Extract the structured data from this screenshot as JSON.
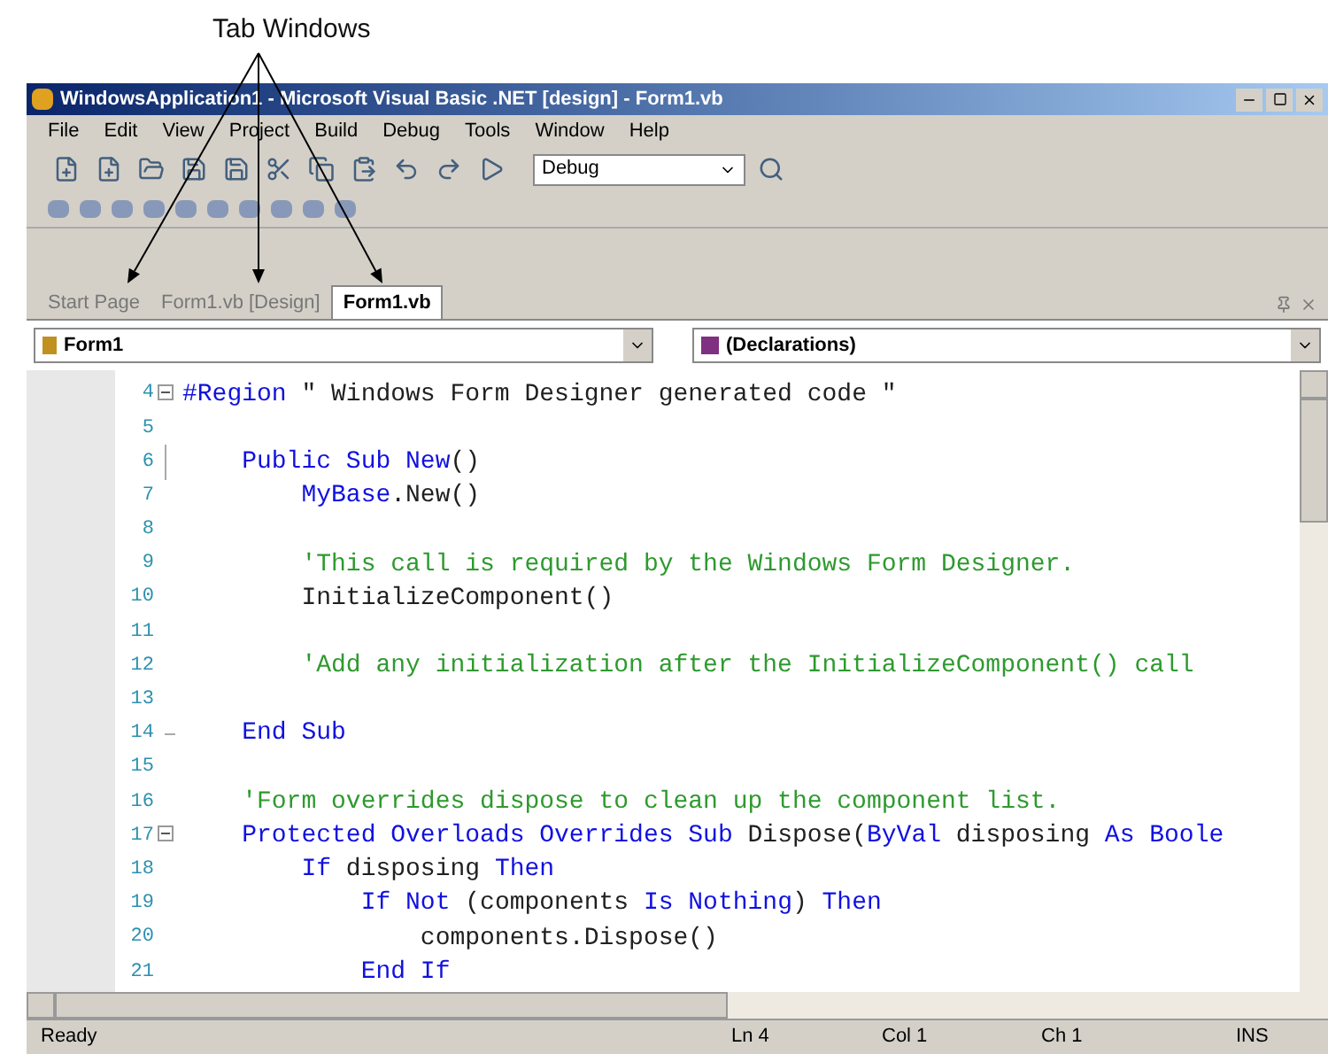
{
  "annotation": {
    "label": "Tab Windows"
  },
  "window": {
    "title": "WindowsApplication1 - Microsoft Visual Basic .NET [design] - Form1.vb"
  },
  "menu": [
    "File",
    "Edit",
    "View",
    "Project",
    "Build",
    "Debug",
    "Tools",
    "Window",
    "Help"
  ],
  "toolbar": {
    "configuration": "Debug"
  },
  "tabs": [
    {
      "label": "Start Page",
      "selected": false
    },
    {
      "label": "Form1.vb [Design]",
      "selected": false
    },
    {
      "label": "Form1.vb",
      "selected": true
    }
  ],
  "class_dropdown": {
    "value": "Form1"
  },
  "method_dropdown": {
    "value": "(Declarations)"
  },
  "code_lines": [
    {
      "number": "4",
      "kind": "collapsible",
      "segments": [
        {
          "kind": "keyword",
          "text": "#Region"
        },
        {
          "kind": "text",
          "text": " \" Windows Form Designer generated code \""
        }
      ]
    },
    {
      "number": "5"
    },
    {
      "number": "6",
      "kind": "guide",
      "segments": [
        {
          "kind": "keyword",
          "text": "    Public Sub New"
        },
        {
          "kind": "text",
          "text": "()"
        }
      ]
    },
    {
      "number": "7",
      "segments": [
        {
          "kind": "keyword",
          "text": "        MyBase"
        },
        {
          "kind": "text",
          "text": ".New()"
        }
      ]
    },
    {
      "number": "8"
    },
    {
      "number": "9",
      "segments": [
        {
          "kind": "comment",
          "text": "        'This call is required by the Windows Form Designer."
        }
      ]
    },
    {
      "number": "10",
      "segments": [
        {
          "kind": "text",
          "text": "        InitializeComponent()"
        }
      ]
    },
    {
      "number": "11"
    },
    {
      "number": "12",
      "segments": [
        {
          "kind": "comment",
          "text": "        'Add any initialization after the InitializeComponent() call"
        }
      ]
    },
    {
      "number": "13"
    },
    {
      "number": "14",
      "kind": "closing",
      "segments": [
        {
          "kind": "keyword",
          "text": "    End Sub"
        }
      ]
    },
    {
      "number": "15"
    },
    {
      "number": "16",
      "segments": [
        {
          "kind": "comment",
          "text": "    'Form overrides dispose to clean up the component list."
        }
      ]
    },
    {
      "number": "17",
      "kind": "collapsible",
      "segments": [
        {
          "kind": "keyword",
          "text": "    Protected Overloads Overrides Sub"
        },
        {
          "kind": "text",
          "text": " Dispose("
        },
        {
          "kind": "keyword",
          "text": "ByVal"
        },
        {
          "kind": "text",
          "text": " disposing "
        },
        {
          "kind": "keyword",
          "text": "As Boole"
        }
      ]
    },
    {
      "number": "18",
      "segments": [
        {
          "kind": "keyword",
          "text": "        If"
        },
        {
          "kind": "text",
          "text": " disposing "
        },
        {
          "kind": "keyword",
          "text": "Then"
        }
      ]
    },
    {
      "number": "19",
      "segments": [
        {
          "kind": "keyword",
          "text": "            If Not"
        },
        {
          "kind": "text",
          "text": " (components "
        },
        {
          "kind": "keyword",
          "text": "Is Nothing"
        },
        {
          "kind": "text",
          "text": ") "
        },
        {
          "kind": "keyword",
          "text": "Then"
        }
      ]
    },
    {
      "number": "20",
      "segments": [
        {
          "kind": "text",
          "text": "                components.Dispose()"
        }
      ]
    },
    {
      "number": "21",
      "segments": [
        {
          "kind": "keyword",
          "text": "            End If"
        }
      ]
    }
  ],
  "status_bar": {
    "message": "Ready",
    "line": "Ln 4",
    "column": "Col 1",
    "character": "Ch 1",
    "mode": "INS"
  }
}
